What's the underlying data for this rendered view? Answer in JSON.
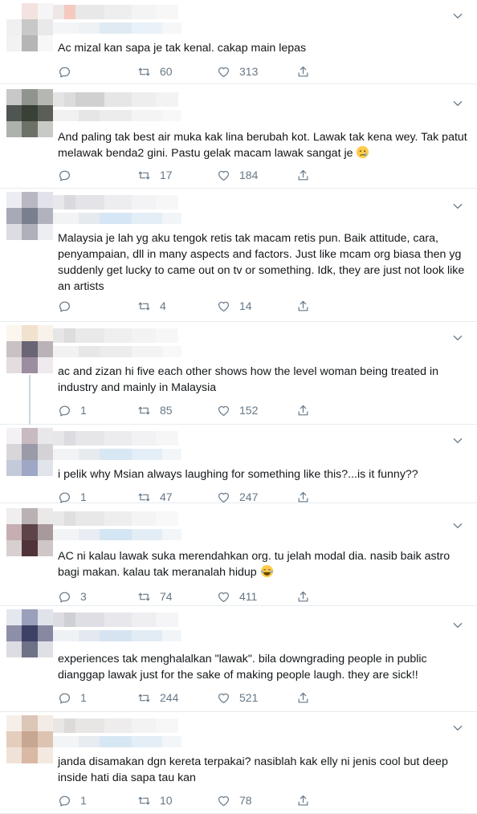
{
  "tweets": [
    {
      "text": "Ac mizal kan sapa je tak kenal. cakap main lepas",
      "replies": "",
      "retweets": "60",
      "likes": "313",
      "avatar_colors": [
        "#ffffff",
        "#f2e3e1",
        "#f5f5f5",
        "#f0f0f0",
        "#c8c8c8",
        "#e9e9e9",
        "#f2f2f2",
        "#b5b5b5",
        "#f7f7f7"
      ],
      "name_colors": [
        "#efe6e6",
        "#f5c9c0",
        "#e8e8e8",
        "#eeeeee",
        "#f4f4f4",
        "#f7f7f7"
      ],
      "handle_colors": [
        "#f3f5f7",
        "#eef2f5",
        "#dfeaf2",
        "#e9f2f8",
        "#f5f7f9"
      ]
    },
    {
      "text": "And paling tak best air muka kak lina berubah kot. Lawak tak kena wey. Tak patut melawak benda2 gini. Pastu gelak macam lawak sangat je ",
      "emoji": "sad-crying-emoji",
      "replies": "",
      "retweets": "17",
      "likes": "184",
      "avatar_colors": [
        "#c8c8c8",
        "#8f958e",
        "#b4b7b2",
        "#4f5550",
        "#394036",
        "#5a5e56",
        "#aeb2ad",
        "#6d7268",
        "#c8cac6"
      ],
      "name_colors": [
        "#e4e4e4",
        "#dcdcdc",
        "#d0d0d0",
        "#e6e6e6",
        "#eeeeee",
        "#f3f3f3"
      ],
      "handle_colors": [
        "#f1f1f1",
        "#e6e6e6",
        "#ececec",
        "#f4f4f4",
        "#f8f8f8"
      ]
    },
    {
      "text": "Malaysia je lah yg aku tengok retis tak macam retis pun. Baik attitude, cara, penyampaian, dll in many aspects and factors. Just like mcam org biasa then yg suddenly get lucky to came out on tv or something. Idk, they are just not look like an artists",
      "replies": "",
      "retweets": "4",
      "likes": "14",
      "avatar_colors": [
        "#ebedf2",
        "#b9b7c1",
        "#e2e3ea",
        "#a7a9b6",
        "#7a7f8f",
        "#b0b3bd",
        "#dcdde3",
        "#aeb0ba",
        "#eceef2"
      ],
      "name_colors": [
        "#e8e8ec",
        "#dadade",
        "#e4e4e8",
        "#ededf0",
        "#f3f3f5",
        "#f7f7f8"
      ],
      "handle_colors": [
        "#f1f3f5",
        "#e5eaee",
        "#d6e6f4",
        "#e3eef7",
        "#f2f5f8"
      ]
    },
    {
      "text": "ac and zizan hi five each other shows how the level woman being treated in industry and mainly in Malaysia",
      "replies": "1",
      "retweets": "85",
      "likes": "152",
      "avatar_colors": [
        "#fbf6ee",
        "#f1e2d0",
        "#f8f2ea",
        "#c9c2c4",
        "#6a6574",
        "#b9b2b6",
        "#e3dde0",
        "#9c8ea0",
        "#efeaee"
      ],
      "name_colors": [
        "#e6e6e6",
        "#dddddd",
        "#e9e9e9",
        "#efefef",
        "#f3f3f3",
        "#f7f7f7"
      ],
      "handle_colors": [
        "#f2f2f2",
        "#e7e7e7",
        "#ececec",
        "#f3f3f3",
        "#f8f8f8"
      ]
    },
    {
      "text": "i pelik why Msian always laughing for something like this?...is it funny??",
      "replies": "1",
      "retweets": "47",
      "likes": "247",
      "avatar_colors": [
        "#f3f1f3",
        "#c7bac0",
        "#eae7ea",
        "#d9d6da",
        "#9a9aa8",
        "#d5d2d6",
        "#c4cad9",
        "#9ea8c6",
        "#e2e4ec"
      ],
      "name_colors": [
        "#e7e7ea",
        "#dcdce0",
        "#e6e6e9",
        "#ececef",
        "#f2f2f4",
        "#f6f6f7"
      ],
      "handle_colors": [
        "#f1f3f5",
        "#e6ebf0",
        "#d8e7f4",
        "#e4eef7",
        "#f3f6f8"
      ]
    },
    {
      "text": "AC ni kalau lawak suka merendahkan org. tu jelah modal dia. nasib baik astro bagi makan. kalau tak meranalah hidup ",
      "emoji": "tears-of-joy-emoji",
      "replies": "3",
      "retweets": "74",
      "likes": "411",
      "avatar_colors": [
        "#f0eeee",
        "#b9b1b3",
        "#ebe8e8",
        "#c6aeb2",
        "#5d4448",
        "#a89a9c",
        "#d7cfd0",
        "#503338",
        "#cfc6c7"
      ],
      "name_colors": [
        "#e9e9e9",
        "#dfdfdf",
        "#e8e8e8",
        "#eeeeee",
        "#f4f4f4",
        "#f8f8f8"
      ],
      "handle_colors": [
        "#f3f4f6",
        "#e7edf2",
        "#d4e5f3",
        "#e3edf6",
        "#f3f6f9"
      ]
    },
    {
      "text": "experiences tak menghalalkan \"lawak\". bila downgrading people in public dianggap lawak just for the sake of making people laugh. they are sick!!",
      "replies": "1",
      "retweets": "244",
      "likes": "521",
      "avatar_colors": [
        "#e5e7ef",
        "#9aa0bb",
        "#e1e3eb",
        "#8d8fa9",
        "#3d4166",
        "#8789a3",
        "#dcdce3",
        "#6f7187",
        "#dfe0e6"
      ],
      "name_colors": [
        "#dcdce2",
        "#cfcfd6",
        "#dedee4",
        "#e7e7ec",
        "#efeff2",
        "#f5f5f7"
      ],
      "handle_colors": [
        "#eff2f5",
        "#e3e9ef",
        "#d6e4f2",
        "#e2ecf5",
        "#f2f5f8"
      ]
    },
    {
      "text": "janda disamakan dgn kereta terpakai? nasiblah kak elly ni jenis cool but deep inside hati dia sapa tau kan",
      "replies": "1",
      "retweets": "10",
      "likes": "78",
      "avatar_colors": [
        "#f6efe9",
        "#dcc6b8",
        "#f3ebe5",
        "#e4cdbd",
        "#c7a792",
        "#ddc3b1",
        "#f0e2d8",
        "#d9b9a3",
        "#f3e9e1"
      ],
      "name_colors": [
        "#e9e6e6",
        "#dedada",
        "#e8e5e5",
        "#eeecec",
        "#f4f3f3",
        "#f8f7f7"
      ],
      "handle_colors": [
        "#f2f4f6",
        "#e6ecf1",
        "#d7e7f4",
        "#e3eef7",
        "#f3f6f9"
      ]
    }
  ]
}
